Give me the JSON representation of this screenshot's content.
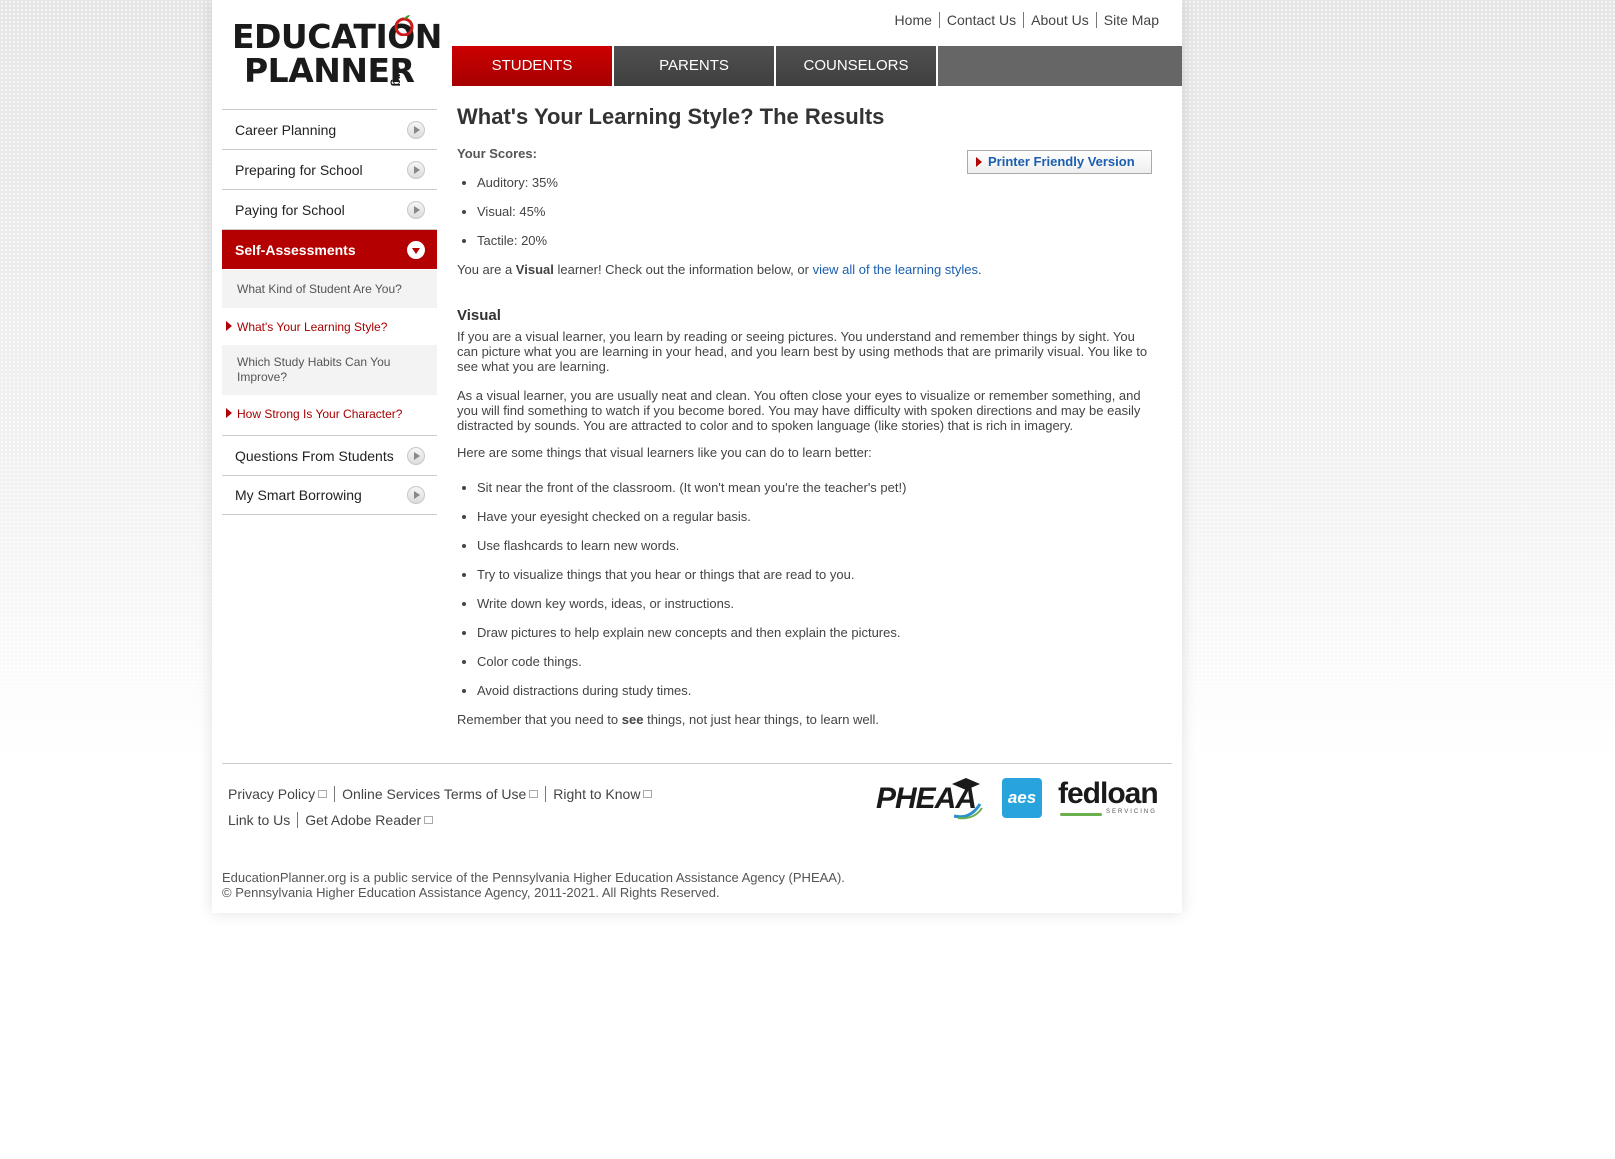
{
  "logo": {
    "line1": "EDUCATION",
    "line2": "PLANNER",
    "suffix": ".org"
  },
  "util_nav": [
    "Home",
    "Contact Us",
    "About Us",
    "Site Map"
  ],
  "tabs": [
    "STUDENTS",
    "PARENTS",
    "COUNSELORS"
  ],
  "sidebar": {
    "items": [
      "Career Planning",
      "Preparing for School",
      "Paying for School",
      "Self-Assessments",
      "Questions From Students",
      "My Smart Borrowing"
    ],
    "subitems": [
      "What Kind of Student Are You?",
      "What's Your Learning Style?",
      "Which Study Habits Can You Improve?",
      "How Strong Is Your Character?"
    ]
  },
  "content": {
    "title": "What's Your Learning Style? The Results",
    "scores_label": "Your Scores:",
    "printer": "Printer Friendly Version",
    "scores": [
      "Auditory: 35%",
      "Visual: 45%",
      "Tactile: 20%"
    ],
    "result_pre": "You are a ",
    "result_bold": "Visual",
    "result_mid": " learner! Check out the information below, or ",
    "result_link": "view all of the learning styles",
    "result_end": ".",
    "section_title": "Visual",
    "p1": "If you are a visual learner, you learn by reading or seeing pictures. You understand and remember things by sight. You can picture what you are learning in your head, and you learn best by using methods that are primarily visual. You like to see what you are learning.",
    "p2": "As a visual learner, you are usually neat and clean. You often close your eyes to visualize or remember something, and you will find something to watch if you become bored. You may have difficulty with spoken directions and may be easily distracted by sounds. You are attracted to color and to spoken language (like stories) that is rich in imagery.",
    "p3": "Here are some things that visual learners like you can do to learn better:",
    "tips": [
      "Sit near the front of the classroom. (It won't mean you're the teacher's pet!)",
      "Have your eyesight checked on a regular basis.",
      "Use flashcards to learn new words.",
      "Try to visualize things that you hear or things that are read to you.",
      "Write down key words, ideas, or instructions.",
      "Draw pictures to help explain new concepts and then explain the pictures.",
      "Color code things.",
      "Avoid distractions during study times."
    ],
    "closing_pre": "Remember that you need to ",
    "closing_bold": "see",
    "closing_end": " things, not just hear things, to learn well."
  },
  "footer": {
    "links_row1": [
      "Privacy Policy",
      "Online Services Terms of Use",
      "Right to Know"
    ],
    "links_row2": [
      "Link to Us",
      "Get Adobe Reader"
    ],
    "logos": [
      "PHEAA",
      "aes",
      "fedloan",
      "SERVICING"
    ],
    "copyright1": "EducationPlanner.org is a public service of the Pennsylvania Higher Education Assistance Agency (PHEAA).",
    "copyright2": "© Pennsylvania Higher Education Assistance Agency, 2011-2021. All Rights Reserved."
  },
  "colors": {
    "brand_red": "#b40000",
    "link_blue": "#1a5eb0",
    "tab_gray": "#4a4a4a"
  }
}
